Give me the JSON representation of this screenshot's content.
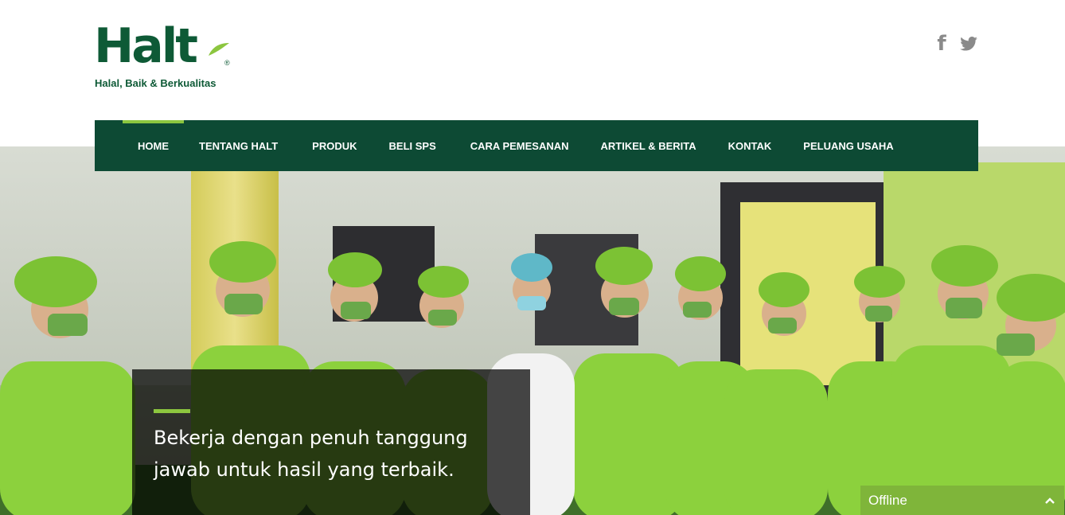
{
  "brand": {
    "wordmark": "Halt",
    "registered": "®",
    "tagline": "Halal, Baik & Berkualitas"
  },
  "social": [
    {
      "icon": "facebook-icon",
      "glyph": "f"
    },
    {
      "icon": "twitter-icon"
    }
  ],
  "nav": {
    "items": [
      {
        "label": "HOME",
        "active": true
      },
      {
        "label": "TENTANG HALT"
      },
      {
        "label": "PRODUK"
      },
      {
        "label": "BELI SPS"
      },
      {
        "label": "CARA PEMESANAN"
      },
      {
        "label": "ARTIKEL & BERITA"
      },
      {
        "label": "KONTAK"
      },
      {
        "label": "PELUANG USAHA"
      }
    ]
  },
  "hero": {
    "caption": "Bekerja dengan penuh tanggung jawab untuk hasil yang terbaik."
  },
  "chat": {
    "status": "Offline",
    "chevron": "^"
  },
  "colors": {
    "brand_green": "#0e5a36",
    "nav_bg": "#0d4a34",
    "accent": "#8cc63f",
    "chat_bg": "#7fb53a"
  }
}
